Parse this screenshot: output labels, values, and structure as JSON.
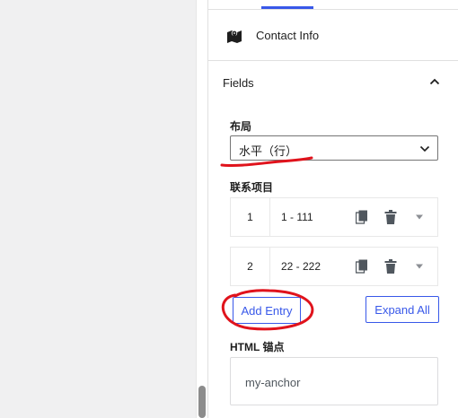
{
  "block": {
    "title": "Contact Info",
    "icon": "map-icon"
  },
  "panel": {
    "section_title": "Fields",
    "section_icon": "chevron-up-icon"
  },
  "layout_field": {
    "label": "布局",
    "value": "水平（行）"
  },
  "items_field": {
    "label": "联系项目",
    "entries": [
      {
        "index": "1",
        "title": "1 - 111"
      },
      {
        "index": "2",
        "title": "22 - 222"
      }
    ]
  },
  "buttons": {
    "add": "Add Entry",
    "expand": "Expand All"
  },
  "anchor_field": {
    "label": "HTML 锚点",
    "value": "my-anchor"
  },
  "colors": {
    "accent": "#3858e9",
    "annotation": "#e0131c",
    "border": "#e0e0e0"
  }
}
